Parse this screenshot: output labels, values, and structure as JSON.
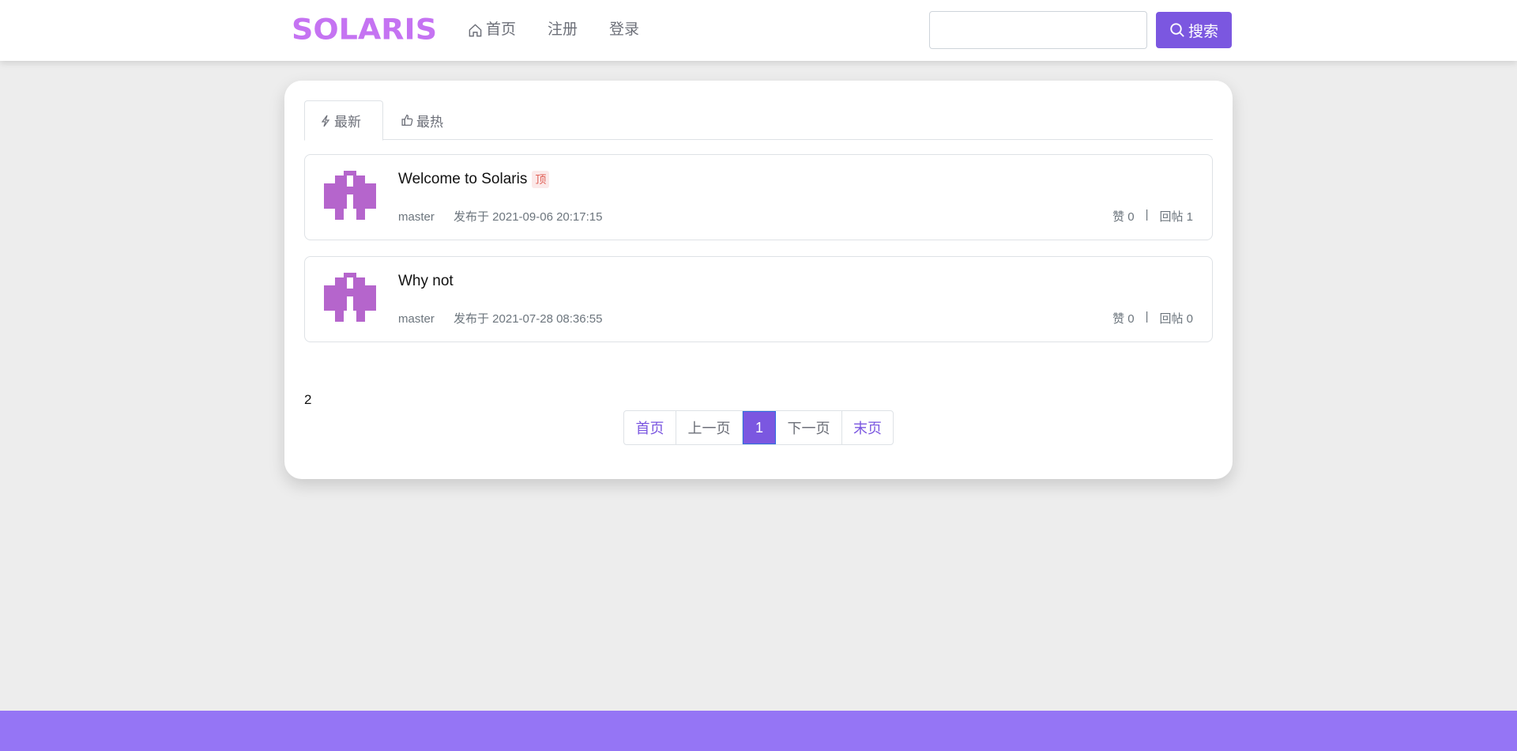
{
  "header": {
    "logo_text": "SOLARIS",
    "nav": [
      {
        "label": "首页",
        "icon": "home-icon"
      },
      {
        "label": "注册"
      },
      {
        "label": "登录"
      }
    ],
    "search": {
      "value": "",
      "placeholder": "",
      "button_label": "搜索",
      "button_icon": "search-icon"
    }
  },
  "tabs": [
    {
      "label": "最新",
      "icon": "lightning-icon",
      "active": true
    },
    {
      "label": "最热",
      "icon": "thumbs-up-icon",
      "active": false
    }
  ],
  "posts": [
    {
      "title": "Welcome to Solaris",
      "badge": "顶",
      "author": "master",
      "published": "发布于 2021-09-06 20:17:15",
      "likes": "赞 0",
      "replies": "回帖 1"
    },
    {
      "title": "Why not",
      "badge": "",
      "author": "master",
      "published": "发布于 2021-07-28 08:36:55",
      "likes": "赞 0",
      "replies": "回帖 0"
    }
  ],
  "stats_separator": "|",
  "total_count": "2",
  "pagination": {
    "first": "首页",
    "prev": "上一页",
    "current": "1",
    "next": "下一页",
    "last": "末页"
  },
  "colors": {
    "accent": "#7b57e0",
    "logo": "#c573f2",
    "footer": "#9575f5",
    "avatar": "#b565cc",
    "background": "#ededed"
  }
}
